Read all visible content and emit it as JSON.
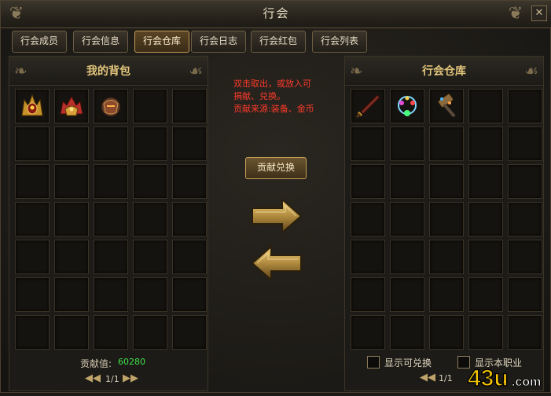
{
  "window": {
    "title": "行会"
  },
  "tabs": [
    {
      "label": "行会成员"
    },
    {
      "label": "行会信息"
    },
    {
      "label": "行会仓库",
      "active": true
    },
    {
      "label": "行会日志"
    },
    {
      "label": "行会红包"
    },
    {
      "label": "行会列表"
    }
  ],
  "bag": {
    "title": "我的背包",
    "contribution_label": "贡献值:",
    "contribution_value": "60280",
    "page": "1/1",
    "items": [
      "helmet-gold-icon",
      "helmet-red-icon",
      "helmet-dark-icon"
    ]
  },
  "center": {
    "hint_lines": [
      "双击取出，或放入可",
      "捐献、兑换。",
      "贡献来源:装备、金币"
    ],
    "exchange_button": "贡献兑换",
    "deposit_arrow": "arrow-right-icon",
    "withdraw_arrow": "arrow-left-icon"
  },
  "warehouse": {
    "title": "行会仓库",
    "page": "1/1",
    "items": [
      "sword-icon",
      "necklace-icon",
      "hammer-icon"
    ],
    "checkbox_exchangeable": "显示可兑换",
    "checkbox_job": "显示本职业"
  },
  "watermark": {
    "text": "43u.com"
  },
  "colors": {
    "accent": "#e2c57c",
    "hint": "#ff3a2a",
    "contribution": "#3fe04a",
    "tab_active_border": "#c89b55"
  }
}
